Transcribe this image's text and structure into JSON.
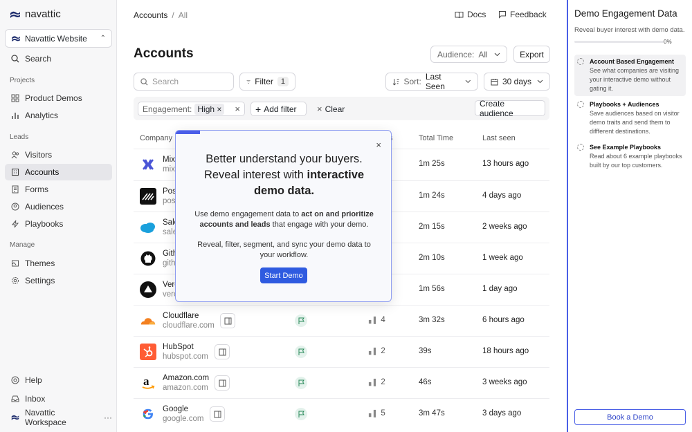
{
  "sidebar": {
    "logo": "navattic",
    "workspace": "Navattic Website",
    "search": "Search",
    "section_projects": "Projects",
    "section_leads": "Leads",
    "section_manage": "Manage",
    "items": {
      "product_demos": "Product Demos",
      "analytics": "Analytics",
      "visitors": "Visitors",
      "accounts": "Accounts",
      "forms": "Forms",
      "audiences": "Audiences",
      "playbooks": "Playbooks",
      "themes": "Themes",
      "settings": "Settings",
      "help": "Help",
      "inbox": "Inbox",
      "workspace_footer": "Navattic Workspace"
    }
  },
  "header": {
    "crumb_root": "Accounts",
    "crumb_sep": "/",
    "crumb_current": "All",
    "docs": "Docs",
    "feedback": "Feedback"
  },
  "page": {
    "title": "Accounts",
    "audience_label": "Audience:",
    "audience_value": "All",
    "export": "Export",
    "search_placeholder": "Search",
    "filter": "Filter",
    "filter_count": "1",
    "sort_label": "Sort:",
    "sort_value": "Last Seen",
    "range": "30 days"
  },
  "filterbar": {
    "engagement_label": "Engagement:",
    "engagement_value": "High",
    "add_filter": "Add filter",
    "clear": "Clear",
    "create_audience": "Create audience"
  },
  "table": {
    "col_company": "Company",
    "col_sessions_frag": "s",
    "col_total_time": "Total Time",
    "col_last_seen": "Last seen",
    "rows": [
      {
        "name": "Mix",
        "domain": "mix",
        "sessions": "",
        "time": "1m 25s",
        "last": "13 hours ago",
        "logo": "mixpanel-logo"
      },
      {
        "name": "Pos",
        "domain": "pos",
        "sessions": "",
        "time": "1m 24s",
        "last": "4 days ago",
        "logo": "postman-logo"
      },
      {
        "name": "Sale",
        "domain": "sale",
        "sessions": "",
        "time": "2m 15s",
        "last": "2 weeks ago",
        "logo": "salesforce-logo"
      },
      {
        "name": "Gith",
        "domain": "gith",
        "sessions": "",
        "time": "2m 10s",
        "last": "1 week ago",
        "logo": "github-logo"
      },
      {
        "name": "Vero",
        "domain": "verc",
        "sessions": "",
        "time": "1m 56s",
        "last": "1 day ago",
        "logo": "vercel-logo"
      },
      {
        "name": "Cloudflare",
        "domain": "cloudflare.com",
        "sessions": "4",
        "time": "3m 32s",
        "last": "6 hours ago",
        "logo": "cloudflare-logo"
      },
      {
        "name": "HubSpot",
        "domain": "hubspot.com",
        "sessions": "2",
        "time": "39s",
        "last": "18 hours ago",
        "logo": "hubspot-logo"
      },
      {
        "name": "Amazon.com",
        "domain": "amazon.com",
        "sessions": "2",
        "time": "46s",
        "last": "3 weeks ago",
        "logo": "amazon-logo"
      },
      {
        "name": "Google",
        "domain": "google.com",
        "sessions": "5",
        "time": "3m 47s",
        "last": "3 days ago",
        "logo": "google-logo"
      }
    ]
  },
  "modal": {
    "headline_a": "Better understand your buyers. Reveal interest with ",
    "headline_b": "interactive demo data.",
    "p1_a": "Use demo engagement data to ",
    "p1_b": "act on and prioritize accounts and leads",
    "p1_c": " that engage with your demo.",
    "p2": "Reveal, filter, segment, and sync your demo data to your workflow.",
    "start": "Start Demo",
    "close": "×"
  },
  "panel": {
    "title": "Demo Engagement Data",
    "subtitle": "Reveal buyer interest with demo data.",
    "progress_pct": "0%",
    "progress_value": 0,
    "steps": [
      {
        "title": "Account Based Engagement",
        "desc": "See what companies are visiting your interactive demo without gating it."
      },
      {
        "title": "Playbooks + Audiences",
        "desc": "Save audiences based on visitor demo traits and send them to diffferent destinations."
      },
      {
        "title": "See Example Playbooks",
        "desc": "Read about 6 example playbooks built by our top customers."
      }
    ],
    "book": "Book a Demo"
  },
  "colors": {
    "accent": "#4a5fe6",
    "primary_button": "#2f5be0",
    "flag_bg": "#e4f2ec"
  }
}
